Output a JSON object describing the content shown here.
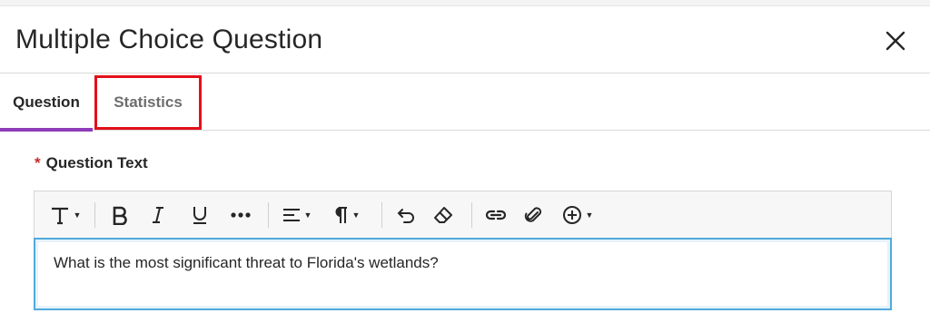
{
  "dialog": {
    "title": "Multiple Choice Question",
    "close_icon": "close-icon"
  },
  "tabs": [
    {
      "label": "Question",
      "active": true
    },
    {
      "label": "Statistics",
      "active": false,
      "highlighted": true
    }
  ],
  "colors": {
    "active_tab_underline": "#8e3cb8",
    "highlight_box": "#e3101b",
    "focus_border": "#52a9dd",
    "required_asterisk": "#c52b2b"
  },
  "question_field": {
    "required_mark": "*",
    "label": "Question Text",
    "value": "What is the most significant threat to Florida's wetlands?"
  },
  "toolbar": {
    "buttons": [
      "text-format-icon",
      "bold-icon",
      "italic-icon",
      "underline-icon",
      "more-icon",
      "align-icon",
      "paragraph-icon",
      "undo-icon",
      "eraser-icon",
      "link-icon",
      "attachment-icon",
      "insert-icon"
    ]
  }
}
